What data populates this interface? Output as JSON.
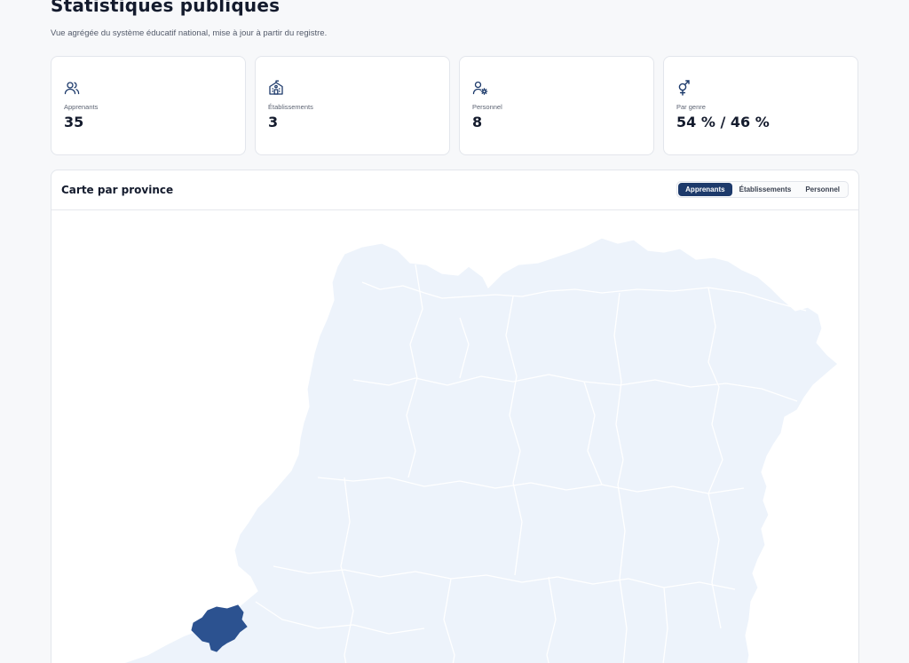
{
  "page": {
    "title": "Statistiques publiques",
    "subtitle": "Vue agrégée du système éducatif national, mise à jour à partir du registre."
  },
  "kpis": [
    {
      "icon": "users-icon",
      "label": "Apprenants",
      "value": "35"
    },
    {
      "icon": "school-icon",
      "label": "Établissements",
      "value": "3"
    },
    {
      "icon": "user-gear-icon",
      "label": "Personnel",
      "value": "8"
    },
    {
      "icon": "gender-icon",
      "label": "Par genre",
      "value": "54 % / 46 %"
    }
  ],
  "map": {
    "title": "Carte par province",
    "tabs": [
      {
        "label": "Apprenants",
        "active": true
      },
      {
        "label": "Établissements",
        "active": false
      },
      {
        "label": "Personnel",
        "active": false
      }
    ],
    "highlighted_province_count": 1
  },
  "colors": {
    "accent": "#1d3a6b",
    "map_fill": "#edf3fb",
    "map_highlight": "#2c5290",
    "icon_stroke": "#1d3a6b"
  }
}
